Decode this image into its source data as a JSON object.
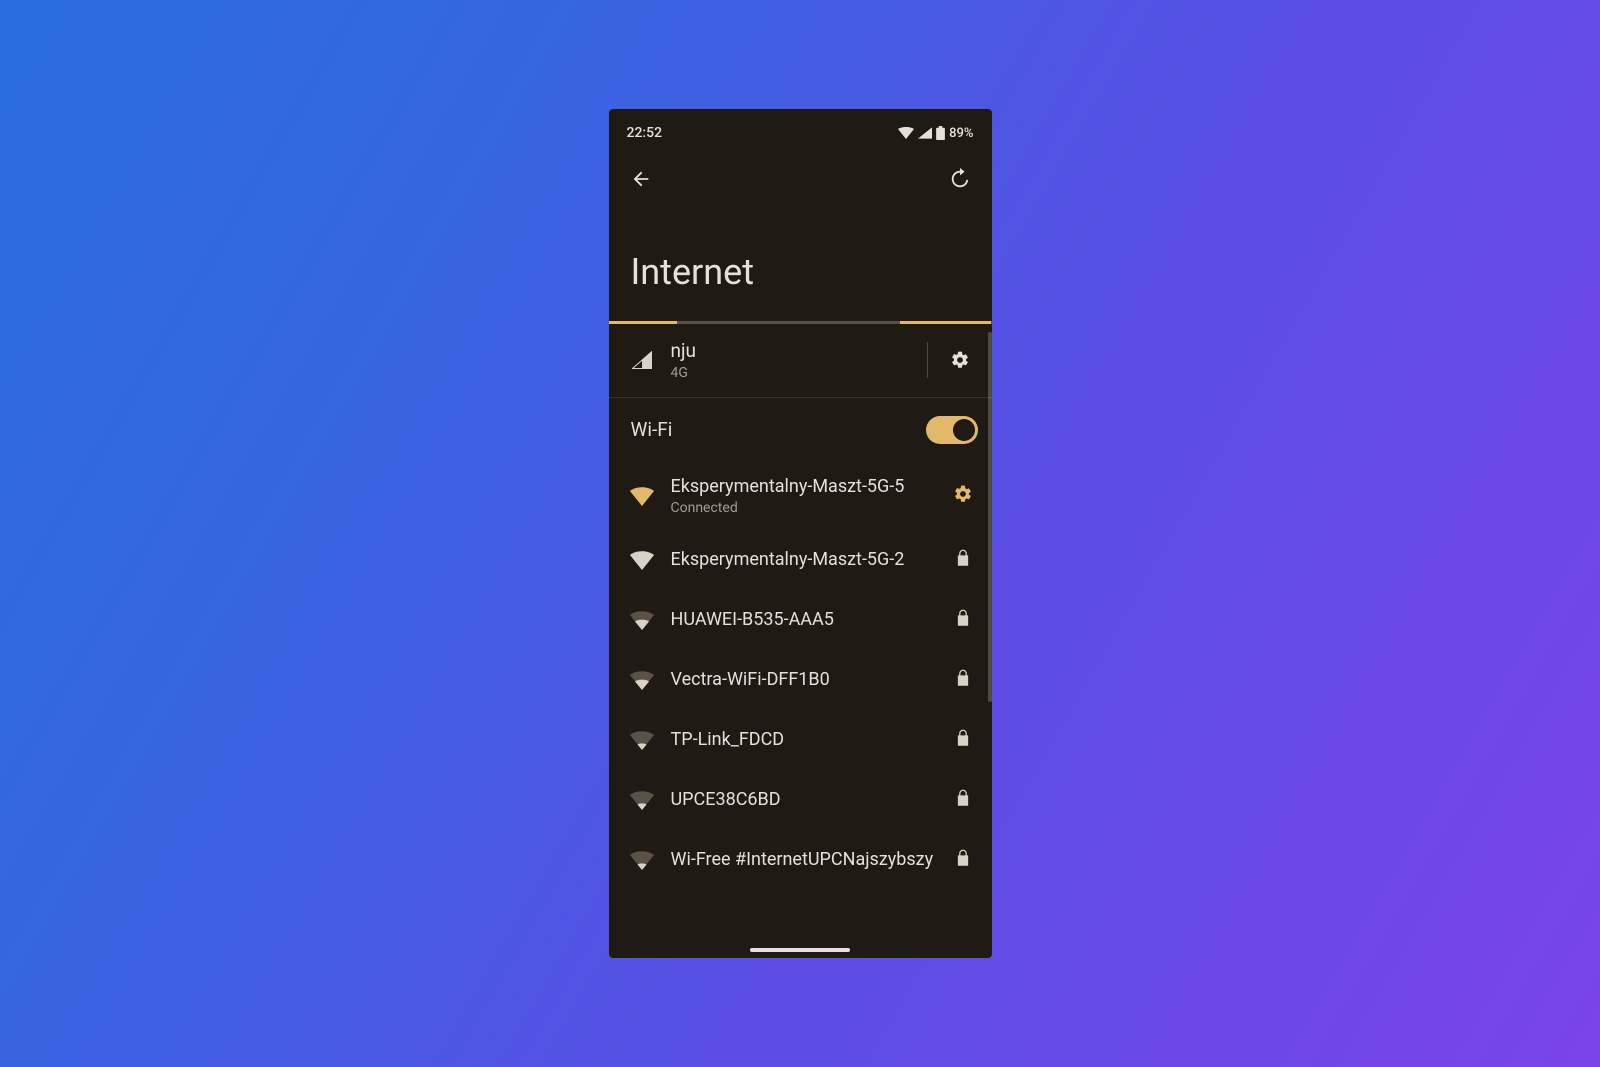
{
  "status": {
    "time": "22:52",
    "battery": "89%"
  },
  "header": {
    "title": "Internet"
  },
  "mobile": {
    "name": "nju",
    "subtitle": "4G"
  },
  "wifi": {
    "label": "Wi-Fi",
    "enabled": true,
    "networks": [
      {
        "name": "Eksperymentalny-Maszt-5G-5",
        "status": "Connected",
        "signal": "full",
        "connected": true,
        "secured": true,
        "trail": "gear"
      },
      {
        "name": "Eksperymentalny-Maszt-5G-2",
        "status": "",
        "signal": "full",
        "connected": false,
        "secured": true,
        "trail": "lock"
      },
      {
        "name": "HUAWEI-B535-AAA5",
        "status": "",
        "signal": "half",
        "connected": false,
        "secured": true,
        "trail": "lock"
      },
      {
        "name": "Vectra-WiFi-DFF1B0",
        "status": "",
        "signal": "half",
        "connected": false,
        "secured": true,
        "trail": "lock"
      },
      {
        "name": "TP-Link_FDCD",
        "status": "",
        "signal": "low",
        "connected": false,
        "secured": true,
        "trail": "lock"
      },
      {
        "name": "UPCE38C6BD",
        "status": "",
        "signal": "low",
        "connected": false,
        "secured": true,
        "trail": "lock"
      },
      {
        "name": "Wi-Free #InternetUPCNajszybszy",
        "status": "",
        "signal": "low",
        "connected": false,
        "secured": true,
        "trail": "lock"
      }
    ]
  },
  "colors": {
    "accent": "#e2b96b",
    "bg": "#1f1a14",
    "text": "#e6e0d8",
    "muted": "#a49c90"
  }
}
